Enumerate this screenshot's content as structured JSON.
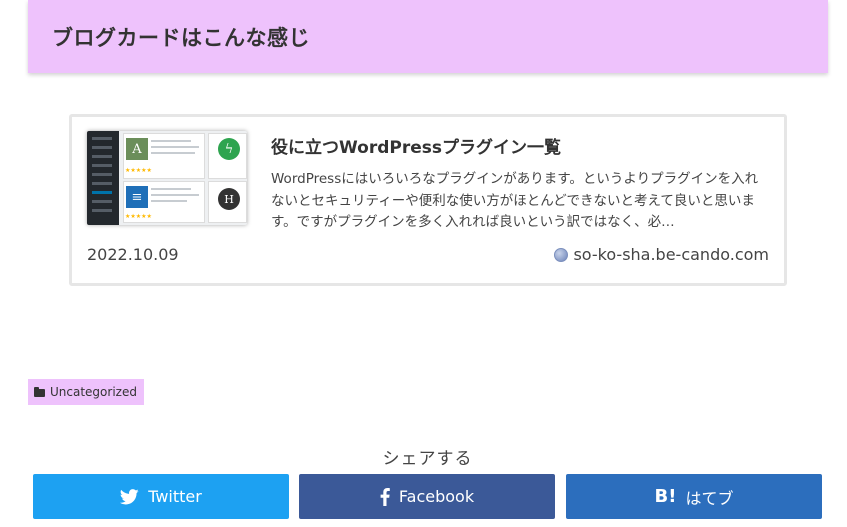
{
  "heading": {
    "title": "ブログカードはこんな感じ"
  },
  "blogcard": {
    "title": "役に立つWordPressプラグイン一覧",
    "excerpt": "WordPressにはいろいろなプラグインがあります。というよりプラグインを入れないとセキュリティーや便利な使い方がほとんどできないと考えて良いと思います。ですがプラグインを多く入れれば良いという訳ではなく、必…",
    "date": "2022.10.09",
    "site": "so-ko-sha.be-cando.com",
    "site_icon": "globe-icon"
  },
  "category": {
    "label": "Uncategorized",
    "icon": "folder-icon"
  },
  "share": {
    "title": "シェアする",
    "buttons": [
      {
        "label": "Twitter",
        "icon": "twitter-bird-icon",
        "color": "#1da1f2"
      },
      {
        "label": "Facebook",
        "icon": "facebook-f-icon",
        "color": "#3b5998"
      },
      {
        "label": "はてブ",
        "icon": "hatena-bookmark-icon",
        "color": "#2c6ebd"
      }
    ]
  },
  "colors": {
    "accent": "#eec2fc"
  }
}
